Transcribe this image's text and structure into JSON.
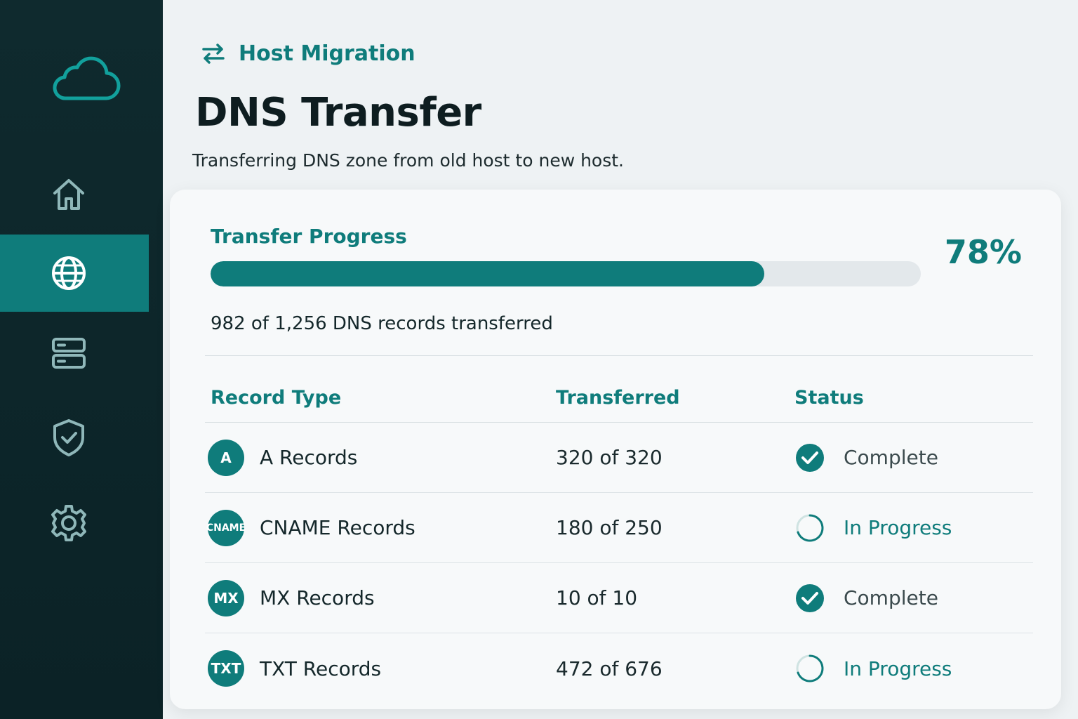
{
  "app": {
    "breadcrumb": "Host Migration",
    "title": "DNS Transfer",
    "subtitle": "Transferring DNS zone from old host to new host."
  },
  "sidebar": {
    "logo_icon": "cloud-icon",
    "items": [
      {
        "icon": "home-icon",
        "active": false
      },
      {
        "icon": "globe-icon",
        "active": true
      },
      {
        "icon": "server-icon",
        "active": false
      },
      {
        "icon": "shield-check-icon",
        "active": false
      },
      {
        "icon": "gear-icon",
        "active": false
      }
    ]
  },
  "progress": {
    "label": "Transfer Progress",
    "percent_text": "78%",
    "fraction": 0.78,
    "detail": "982 of 1,256 DNS records transferred"
  },
  "table": {
    "headers": {
      "type": "Record Type",
      "transferred": "Transferred",
      "status": "Status"
    },
    "rows": [
      {
        "badge": "A",
        "type": "A Records",
        "transferred": "320 of 320",
        "status": "Complete",
        "state": "complete"
      },
      {
        "badge": "CNAME",
        "type": "CNAME Records",
        "transferred": "180 of 250",
        "status": "In Progress",
        "state": "progress"
      },
      {
        "badge": "MX",
        "type": "MX Records",
        "transferred": "10 of 10",
        "status": "Complete",
        "state": "complete"
      },
      {
        "badge": "TXT",
        "type": "TXT Records",
        "transferred": "472 of 676",
        "status": "In Progress",
        "state": "progress"
      }
    ]
  },
  "colors": {
    "accent": "#0f7c7b",
    "sidebar": "#0f2a2e",
    "background": "#eef2f4"
  }
}
